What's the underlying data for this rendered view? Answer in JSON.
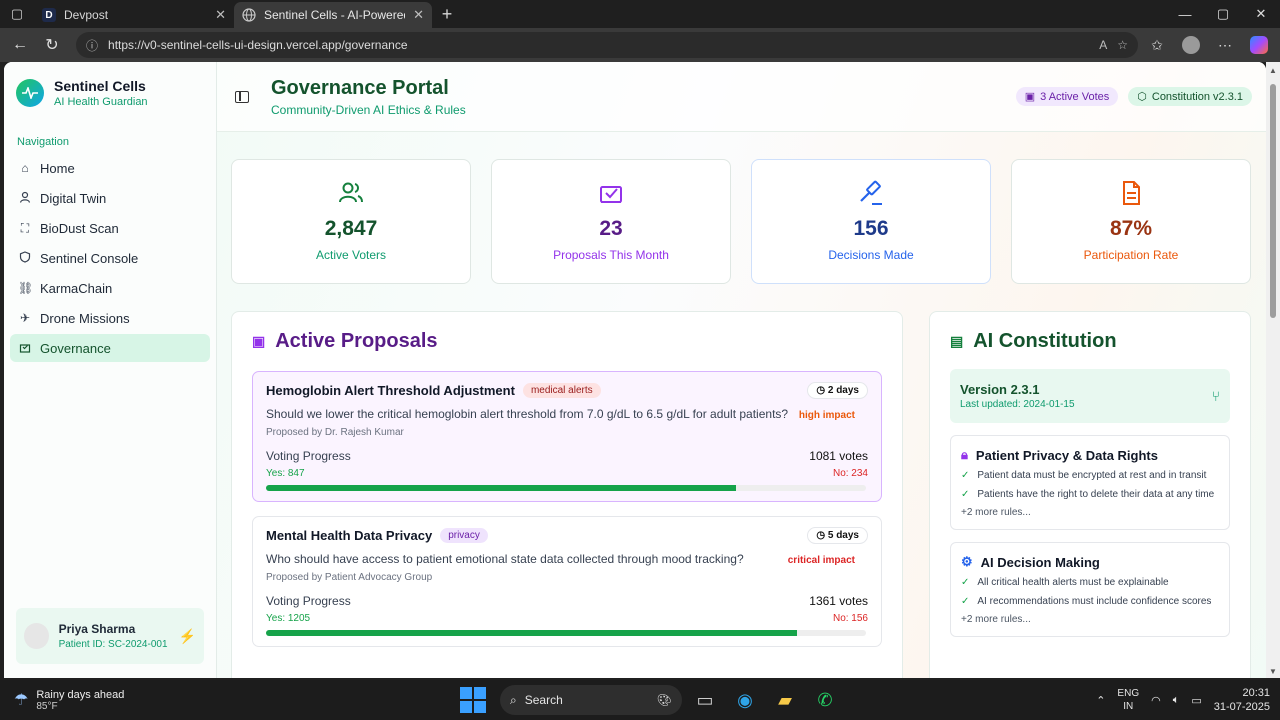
{
  "browser": {
    "tabs": [
      {
        "label": "Devpost",
        "favicon": "D"
      },
      {
        "label": "Sentinel Cells - AI-Powered Thalas",
        "active": true
      }
    ],
    "url": "https://v0-sentinel-cells-ui-design.vercel.app/governance"
  },
  "sidebar": {
    "brand_name": "Sentinel Cells",
    "brand_sub": "AI Health Guardian",
    "nav_heading": "Navigation",
    "items": [
      {
        "label": "Home",
        "icon": "home-icon"
      },
      {
        "label": "Digital Twin",
        "icon": "user-icon"
      },
      {
        "label": "BioDust Scan",
        "icon": "scan-icon"
      },
      {
        "label": "Sentinel Console",
        "icon": "shield-icon"
      },
      {
        "label": "KarmaChain",
        "icon": "link-icon"
      },
      {
        "label": "Drone Missions",
        "icon": "plane-icon"
      },
      {
        "label": "Governance",
        "icon": "vote-icon",
        "active": true
      }
    ],
    "user": {
      "name": "Priya Sharma",
      "id": "Patient ID: SC-2024-001"
    }
  },
  "header": {
    "title": "Governance Portal",
    "subtitle": "Community-Driven AI Ethics & Rules",
    "badge_votes": "3 Active Votes",
    "badge_constitution": "Constitution v2.3.1"
  },
  "stats": [
    {
      "value": "2,847",
      "label": "Active Voters"
    },
    {
      "value": "23",
      "label": "Proposals This Month"
    },
    {
      "value": "156",
      "label": "Decisions Made"
    },
    {
      "value": "87%",
      "label": "Participation Rate"
    }
  ],
  "proposals": {
    "title": "Active Proposals",
    "items": [
      {
        "title": "Hemoglobin Alert Threshold Adjustment",
        "tag": "medical alerts",
        "days": "2 days",
        "impact": "high impact",
        "question": "Should we lower the critical hemoglobin alert threshold from 7.0 g/dL to 6.5 g/dL for adult patients?",
        "proposed_by": "Proposed by Dr. Rajesh Kumar",
        "progress_label": "Voting Progress",
        "votes": "1081 votes",
        "yes": "Yes: 847",
        "no": "No: 234",
        "yes_fraction": 0.783
      },
      {
        "title": "Mental Health Data Privacy",
        "tag": "privacy",
        "days": "5 days",
        "impact": "critical impact",
        "question": "Who should have access to patient emotional state data collected through mood tracking?",
        "proposed_by": "Proposed by Patient Advocacy Group",
        "progress_label": "Voting Progress",
        "votes": "1361 votes",
        "yes": "Yes: 1205",
        "no": "No: 156",
        "yes_fraction": 0.885
      }
    ]
  },
  "constitution": {
    "title": "AI Constitution",
    "version": "Version 2.3.1",
    "updated": "Last updated: 2024-01-15",
    "sections": [
      {
        "title": "Patient Privacy & Data Rights",
        "rules": [
          "Patient data must be encrypted at rest and in transit",
          "Patients have the right to delete their data at any time"
        ],
        "more": "+2 more rules..."
      },
      {
        "title": "AI Decision Making",
        "rules": [
          "All critical health alerts must be explainable",
          "AI recommendations must include confidence scores"
        ],
        "more": "+2 more rules..."
      }
    ]
  },
  "taskbar": {
    "weather_title": "Rainy days ahead",
    "weather_temp": "85°F",
    "search": "Search",
    "lang1": "ENG",
    "lang2": "IN",
    "time": "20:31",
    "date": "31-07-2025"
  }
}
